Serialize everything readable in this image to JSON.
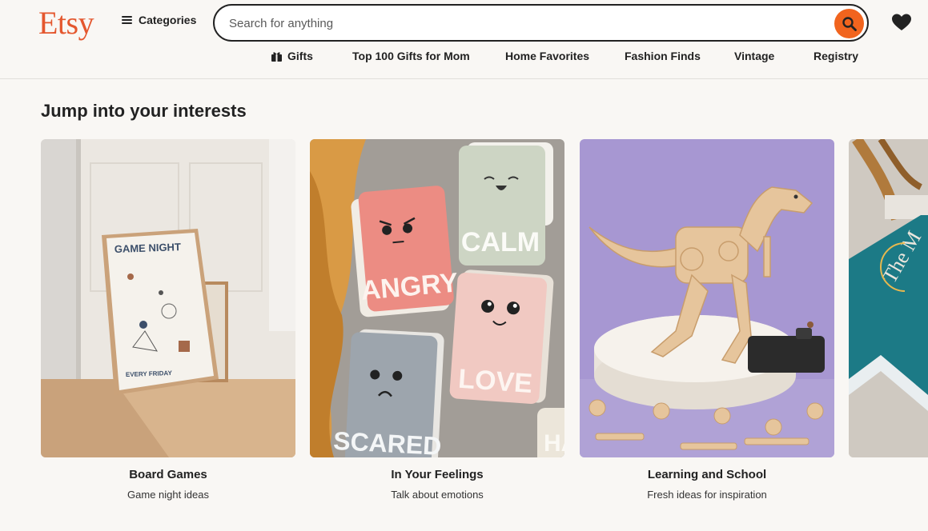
{
  "header": {
    "logo": "Etsy",
    "categories_label": "Categories",
    "search": {
      "placeholder": "Search for anything",
      "value": ""
    }
  },
  "nav": {
    "items": [
      {
        "label": "Gifts",
        "icon": "gift-icon"
      },
      {
        "label": "Top 100 Gifts for Mom"
      },
      {
        "label": "Home Favorites"
      },
      {
        "label": "Fashion Finds"
      },
      {
        "label": "Vintage"
      },
      {
        "label": "Registry"
      }
    ]
  },
  "main": {
    "section_title": "Jump into your interests",
    "cards": [
      {
        "title": "Board Games",
        "subtitle": "Game night ideas",
        "poster_heading": "GAME NIGHT",
        "poster_footer": "EVERY FRIDAY"
      },
      {
        "title": "In Your Feelings",
        "subtitle": "Talk about emotions",
        "card_words": [
          "ANGRY",
          "CALM",
          "LOVE",
          "SCARED",
          "HA"
        ]
      },
      {
        "title": "Learning and School",
        "subtitle": "Fresh ideas for inspiration"
      },
      {
        "title": "",
        "subtitle": "",
        "book_text": "The M"
      }
    ]
  },
  "colors": {
    "brand": "#f1641e",
    "logo": "#e4572e",
    "background": "#f9f7f4",
    "text": "#222222"
  }
}
